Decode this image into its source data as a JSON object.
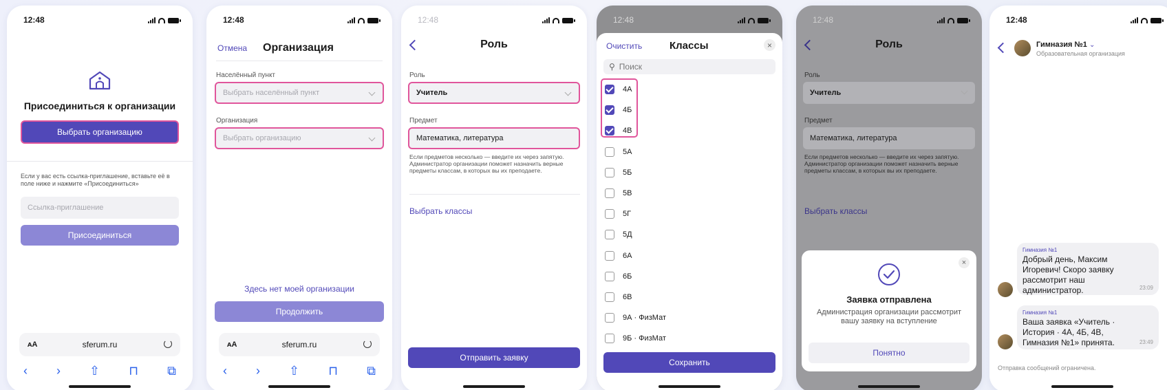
{
  "status_time": "12:48",
  "screen1": {
    "title": "Присоединиться к организации",
    "choose_button": "Выбрать организацию",
    "hint": "Если у вас есть ссылка-приглашение, вставьте её в поле ниже и нажмите «Присоединиться»",
    "invite_placeholder": "Ссылка-приглашение",
    "join_button": "Присоединиться",
    "aa": "ᴀA",
    "url": "sferum.ru"
  },
  "screen2": {
    "cancel": "Отмена",
    "title": "Организация",
    "locality_label": "Населённый пункт",
    "locality_placeholder": "Выбрать населённый пункт",
    "org_label": "Организация",
    "org_placeholder": "Выбрать организацию",
    "no_org_link": "Здесь нет моей организации",
    "continue_button": "Продолжить",
    "aa": "ᴀA",
    "url": "sferum.ru"
  },
  "screen3": {
    "title": "Роль",
    "role_label": "Роль",
    "role_value": "Учитель",
    "subject_label": "Предмет",
    "subject_value": "Математика, литература",
    "hint": "Если предметов несколько — введите их через запятую. Администратор организации поможет назначить верные предметы классам, в которых вы их преподаете.",
    "classes_link": "Выбрать классы",
    "submit_button": "Отправить заявку"
  },
  "screen4": {
    "clear": "Очистить",
    "title": "Классы",
    "search_placeholder": "Поиск",
    "classes": [
      {
        "label": "4А",
        "checked": true
      },
      {
        "label": "4Б",
        "checked": true
      },
      {
        "label": "4В",
        "checked": true
      },
      {
        "label": "5А",
        "checked": false
      },
      {
        "label": "5Б",
        "checked": false
      },
      {
        "label": "5В",
        "checked": false
      },
      {
        "label": "5Г",
        "checked": false
      },
      {
        "label": "5Д",
        "checked": false
      },
      {
        "label": "6А",
        "checked": false
      },
      {
        "label": "6Б",
        "checked": false
      },
      {
        "label": "6В",
        "checked": false
      },
      {
        "label": "9А · ФизМат",
        "checked": false
      },
      {
        "label": "9Б · ФизМат",
        "checked": false
      }
    ],
    "save_button": "Сохранить"
  },
  "screen5": {
    "modal_title": "Заявка отправлена",
    "modal_text": "Администрация организации рассмотрит вашу заявку на вступление",
    "ok_button": "Понятно"
  },
  "screen6": {
    "chat_name": "Гимназия №1",
    "chat_subtitle": "Образовательная организация",
    "messages": [
      {
        "from": "Гимназия №1",
        "text": "Добрый день, Максим Игоревич! Скоро заявку рассмотрит наш администратор.",
        "time": "23:09"
      },
      {
        "from": "Гимназия №1",
        "text": "Ваша заявка «Учитель · История · 4А, 4Б, 4В, Гимназия №1» принята.",
        "time": "23:49"
      }
    ],
    "restricted": "Отправка сообщений ограничена."
  },
  "colors": {
    "accent": "#5148b8",
    "highlight": "#e0559b",
    "soft_button": "#8c87d6"
  }
}
